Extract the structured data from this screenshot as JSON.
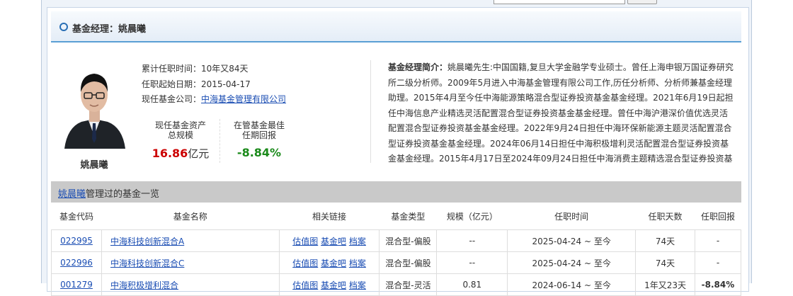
{
  "header": {
    "title": "基金经理：姚晨曦"
  },
  "manager": {
    "name": "姚晨曦",
    "tenure_total": "累计任职时间：10年又84天",
    "start_date": "任职起始日期：2015-04-17",
    "company_label": "现任基金公司：",
    "company": "中海基金管理有限公司",
    "assets_label_1": "现任基金资产",
    "assets_label_2": "总规模",
    "assets_value": "16.86",
    "assets_unit": "亿元",
    "best_label_1": "在管基金最佳",
    "best_label_2": "任期回报",
    "best_value": "-8.84%"
  },
  "bio": {
    "label": "基金经理简介：",
    "text": "姚晨曦先生:中国国籍,复旦大学金融学专业硕士。曾任上海申银万国证券研究所二级分析师。2009年5月进入中海基金管理有限公司工作,历任分析师、分析师兼基金经理助理。2015年4月至今任中海能源策略混合型证券投资基金基金经理。2021年6月19日起担任中海信息产业精选灵活配置混合型证券投资基金基金经理。曾任中海沪港深价值优选灵活配置混合型证券投资基金基金经理。2022年9月24日担任中海环保新能源主题灵活配置混合型证券投资基金基金经理。2024年06月14日担任中海积极增利灵活配置混合型证券投资基金基金经理。2015年4月17日至2024年09月24日担任中海消费主题精选混合型证券投资基金基金"
  },
  "list_section": {
    "name_link": "姚晨曦",
    "title_suffix": "管理过的基金一览"
  },
  "table": {
    "headers": [
      "基金代码",
      "基金名称",
      "相关链接",
      "基金类型",
      "规模（亿元）",
      "任职时间",
      "任职天数",
      "任职回报"
    ],
    "link_labels": [
      "估值图",
      "基金吧",
      "档案"
    ],
    "rows": [
      {
        "code": "022995",
        "name": "中海科技创新混合A",
        "type": "混合型-偏股",
        "scale": "--",
        "period": "2025-04-24 ~ 至今",
        "days": "74天",
        "return": "-"
      },
      {
        "code": "022996",
        "name": "中海科技创新混合C",
        "type": "混合型-偏股",
        "scale": "--",
        "period": "2025-04-24 ~ 至今",
        "days": "74天",
        "return": "-"
      },
      {
        "code": "001279",
        "name": "中海积极增利混合",
        "type": "混合型-灵活",
        "scale": "0.81",
        "period": "2024-06-14 ~ 至今",
        "days": "1年又23天",
        "return": "-8.84%"
      }
    ]
  },
  "colors": {
    "accent": "#1a4db3",
    "positive": "#cc0000",
    "negative": "#1a8a1a",
    "header_rule": "#5a9fd4"
  }
}
